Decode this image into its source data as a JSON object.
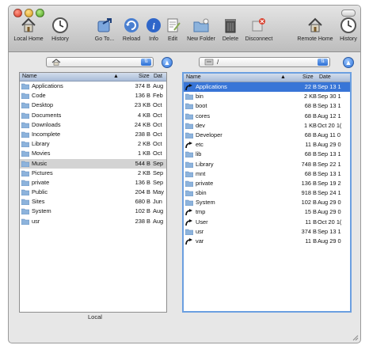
{
  "toolbar": {
    "items": [
      {
        "label": "Local Home",
        "icon": "house-icon"
      },
      {
        "label": "History",
        "icon": "clock-icon"
      },
      {
        "label": "Go To...",
        "icon": "goto-icon"
      },
      {
        "label": "Reload",
        "icon": "reload-icon"
      },
      {
        "label": "Info",
        "icon": "info-icon"
      },
      {
        "label": "Edit",
        "icon": "edit-icon"
      },
      {
        "label": "New Folder",
        "icon": "new-folder-icon"
      },
      {
        "label": "Delete",
        "icon": "trash-icon"
      },
      {
        "label": "Disconnect",
        "icon": "disconnect-icon"
      },
      {
        "label": "Remote Home",
        "icon": "house-icon"
      },
      {
        "label": "History",
        "icon": "clock-icon"
      }
    ]
  },
  "left": {
    "path": "",
    "headers": {
      "name": "Name",
      "size": "Size",
      "date": "Dat"
    },
    "selected_row": 8,
    "rows": [
      {
        "name": "Applications",
        "size": "374 B",
        "date": "Aug"
      },
      {
        "name": "Code",
        "size": "136 B",
        "date": "Feb"
      },
      {
        "name": "Desktop",
        "size": "23 KB",
        "date": "Oct"
      },
      {
        "name": "Documents",
        "size": "4 KB",
        "date": "Oct"
      },
      {
        "name": "Downloads",
        "size": "24 KB",
        "date": "Oct"
      },
      {
        "name": "Incomplete",
        "size": "238 B",
        "date": "Oct"
      },
      {
        "name": "Library",
        "size": "2 KB",
        "date": "Oct"
      },
      {
        "name": "Movies",
        "size": "1 KB",
        "date": "Oct"
      },
      {
        "name": "Music",
        "size": "544 B",
        "date": "Sep"
      },
      {
        "name": "Pictures",
        "size": "2 KB",
        "date": "Sep"
      },
      {
        "name": "private",
        "size": "136 B",
        "date": "Sep"
      },
      {
        "name": "Public",
        "size": "204 B",
        "date": "May"
      },
      {
        "name": "Sites",
        "size": "680 B",
        "date": "Jun"
      },
      {
        "name": "System",
        "size": "102 B",
        "date": "Aug"
      },
      {
        "name": "usr",
        "size": "238 B",
        "date": "Aug"
      }
    ]
  },
  "right": {
    "path": "/",
    "headers": {
      "name": "Name",
      "size": "Size",
      "date": "Date"
    },
    "rows": [
      {
        "name": "Applications",
        "size": "22 B",
        "date": "Sep 13 1",
        "link": true
      },
      {
        "name": "bin",
        "size": "2 KB",
        "date": "Sep 30 1"
      },
      {
        "name": "boot",
        "size": "68 B",
        "date": "Sep 13 1"
      },
      {
        "name": "cores",
        "size": "68 B",
        "date": "Aug 12 1"
      },
      {
        "name": "dev",
        "size": "1 KB",
        "date": "Oct 20 1("
      },
      {
        "name": "Developer",
        "size": "68 B",
        "date": "Aug 11 0"
      },
      {
        "name": "etc",
        "size": "11 B",
        "date": "Aug 29 0",
        "link": true
      },
      {
        "name": "lib",
        "size": "68 B",
        "date": "Sep 13 1"
      },
      {
        "name": "Library",
        "size": "748 B",
        "date": "Sep 22 1"
      },
      {
        "name": "mnt",
        "size": "68 B",
        "date": "Sep 13 1"
      },
      {
        "name": "private",
        "size": "136 B",
        "date": "Sep 19 2"
      },
      {
        "name": "sbin",
        "size": "918 B",
        "date": "Sep 24 1"
      },
      {
        "name": "System",
        "size": "102 B",
        "date": "Aug 29 0"
      },
      {
        "name": "tmp",
        "size": "15 B",
        "date": "Aug 29 0",
        "link": true
      },
      {
        "name": "User",
        "size": "11 B",
        "date": "Oct 20 1(",
        "link": true
      },
      {
        "name": "usr",
        "size": "374 B",
        "date": "Sep 13 1"
      },
      {
        "name": "var",
        "size": "11 B",
        "date": "Aug 29 0",
        "link": true
      }
    ]
  },
  "status": {
    "left_label": "Local"
  },
  "colors": {
    "selection_blue": "#3875d7",
    "selection_gray": "#d3d3d3",
    "folder_blue": "#8db3dc",
    "header_blue": "#b9c8de"
  }
}
